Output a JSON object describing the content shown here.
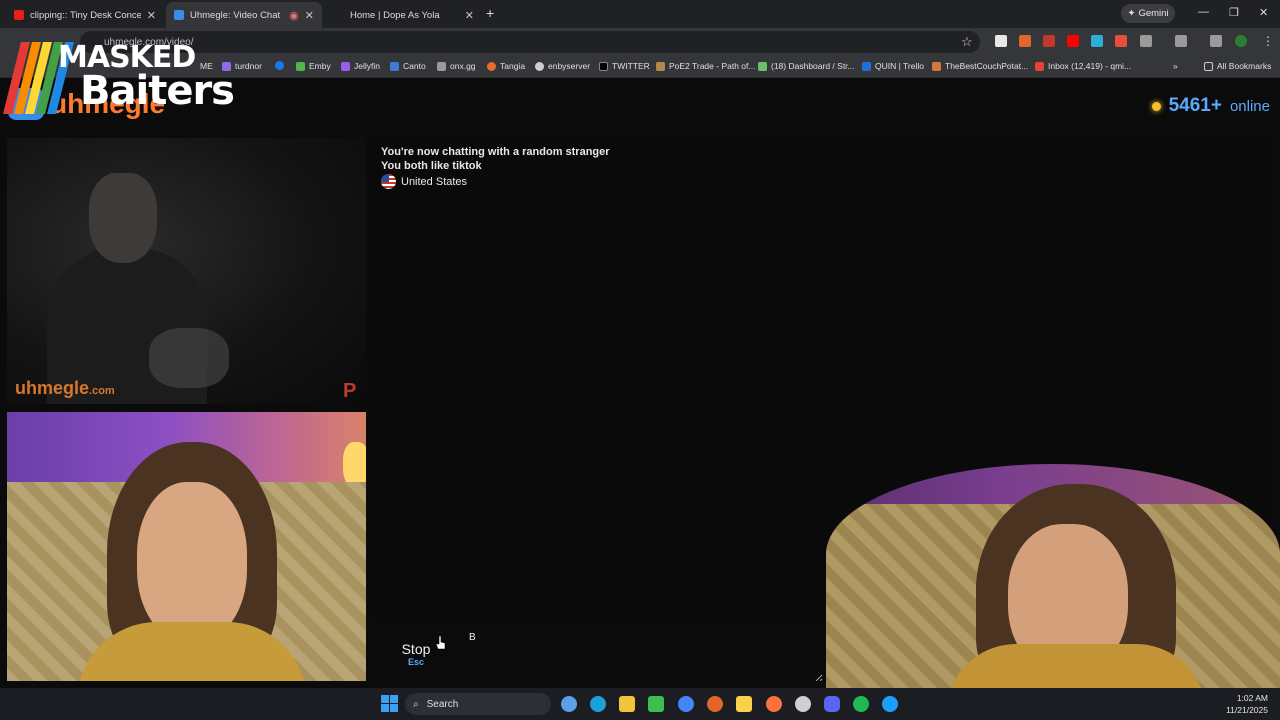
{
  "browser": {
    "tabs": [
      {
        "title": "clipping:: Tiny Desk Concert - Y",
        "icon_color": "#e62117",
        "active": false
      },
      {
        "title": "Uhmegle: Video Chat | Rand",
        "icon_color": "#3b8be8",
        "active": true
      },
      {
        "title": "Home | Dope As Yola",
        "icon_color": "#202124",
        "active": false
      }
    ],
    "new_tab": "+",
    "gemini_label": "Gemini",
    "window_controls": [
      "—",
      "❐",
      "✕"
    ],
    "url": "uhmegle.com/video/",
    "bookmarks": [
      {
        "label": "ME",
        "color": "#888"
      },
      {
        "label": "turdnor",
        "color": "#8e6cf0"
      },
      {
        "label": "",
        "color": "#1877f2"
      },
      {
        "label": "Emby",
        "color": "#52b54b"
      },
      {
        "label": "Jellyfin",
        "color": "#9b5de5"
      },
      {
        "label": "Canto",
        "color": "#3e7bd6"
      },
      {
        "label": "onx.gg",
        "color": "#9a9a9a"
      },
      {
        "label": "Tangia",
        "color": "#e66b2e"
      },
      {
        "label": "enbyserver",
        "color": "#cfcfcf"
      },
      {
        "label": "TWITTER",
        "color": "#000000"
      },
      {
        "label": "PoE2 Trade - Path of...",
        "color": "#b08a4a"
      },
      {
        "label": "(18) Dashboard / Str...",
        "color": "#6ac16a"
      },
      {
        "label": "QUIN | Trello",
        "color": "#1f6fd6"
      },
      {
        "label": "TheBestCouchPotat...",
        "color": "#d27a3e"
      },
      {
        "label": "Inbox (12,419) - qmi...",
        "color": "#e94235"
      }
    ],
    "all_bookmarks": "All Bookmarks"
  },
  "watermark": {
    "line1": "MASKED",
    "line2": "Baiters",
    "stripe_colors": [
      "#e53935",
      "#fb8c00",
      "#fdd835",
      "#43a047",
      "#1e88e5"
    ]
  },
  "site": {
    "name": "uhmegle",
    "online_count": "5461+",
    "online_label": "online"
  },
  "stranger_video": {
    "watermark": "uhmegle",
    "watermark_suffix": ".com",
    "badge": "P"
  },
  "chat": {
    "lines": [
      "You're now chatting with a random stranger",
      "You both like tiktok"
    ],
    "country": "United States"
  },
  "controls": {
    "stop_label": "Stop",
    "stop_key": "Esc",
    "message_value": "B"
  },
  "taskbar": {
    "search_label": "Search",
    "time": "1:02 AM",
    "date": "11/21/2025",
    "apps": [
      {
        "name": "widgets",
        "color": "#5aa0e8"
      },
      {
        "name": "edge",
        "color": "#1c9ed9"
      },
      {
        "name": "explorer",
        "color": "#f3c33a"
      },
      {
        "name": "media",
        "color": "#3fbf4f"
      },
      {
        "name": "chrome",
        "color": "#4285f4"
      },
      {
        "name": "basketball",
        "color": "#e0662b"
      },
      {
        "name": "sticky-notes",
        "color": "#f7d24a"
      },
      {
        "name": "firefox",
        "color": "#ff7139"
      },
      {
        "name": "game",
        "color": "#cfcfcf"
      },
      {
        "name": "discord",
        "color": "#5865f2"
      },
      {
        "name": "spotify",
        "color": "#1db954"
      },
      {
        "name": "steam",
        "color": "#1a9fff"
      }
    ]
  }
}
